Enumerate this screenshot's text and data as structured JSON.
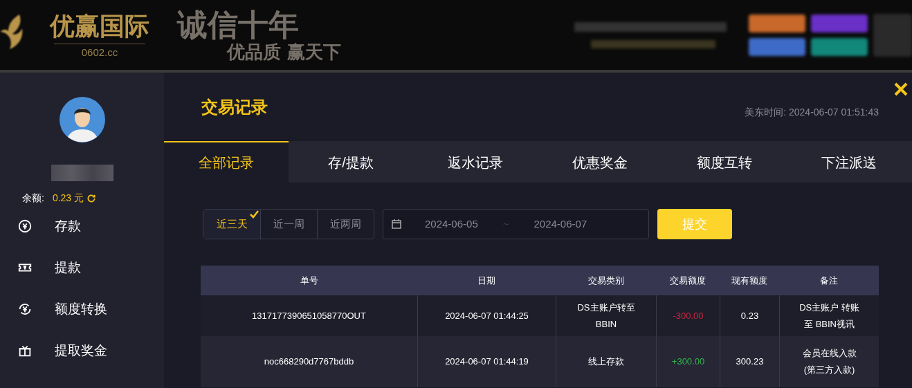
{
  "header": {
    "brand": "优赢国际",
    "domain": "0602.cc",
    "slogan": "诚信十年",
    "slogan_sub": "优品质 赢天下"
  },
  "sidebar": {
    "balance_label": "余额:",
    "balance": "0.23",
    "currency": "元",
    "items": [
      {
        "label": "存款",
        "kind": "deposit",
        "selected": false
      },
      {
        "label": "提款",
        "kind": "withdraw",
        "selected": false
      },
      {
        "label": "额度转换",
        "kind": "transfer",
        "selected": false
      },
      {
        "label": "提取奖金",
        "kind": "gift",
        "selected": false
      }
    ]
  },
  "panel": {
    "title": "交易记录",
    "time_label": "美东时间:",
    "time": "2024-06-07 01:51:43"
  },
  "tabs": [
    {
      "label": "全部记录",
      "selected": true
    },
    {
      "label": "存/提款",
      "selected": false
    },
    {
      "label": "返水记录",
      "selected": false
    },
    {
      "label": "优惠奖金",
      "selected": false
    },
    {
      "label": "额度互转",
      "selected": false
    },
    {
      "label": "下注派送",
      "selected": false
    }
  ],
  "ranges": [
    {
      "label": "近三天",
      "selected": true
    },
    {
      "label": "近一周",
      "selected": false
    },
    {
      "label": "近两周",
      "selected": false
    }
  ],
  "date_from": "2024-06-05",
  "date_sep": "~",
  "date_to": "2024-06-07",
  "submit": "提交",
  "table": {
    "columns": [
      "单号",
      "日期",
      "交易类别",
      "交易额度",
      "现有额度",
      "备注"
    ],
    "rows": [
      {
        "id": "1317177390651058770OUT",
        "date": "2024-06-07 01:44:25",
        "type": "DS主账户转至BBIN",
        "amount": "-300.00",
        "kind": "negative",
        "balance": "0.23",
        "note": "DS主账户 转账至 BBIN视讯"
      },
      {
        "id": "noc668290d7767bddb",
        "date": "2024-06-07 01:44:19",
        "type": "线上存款",
        "amount": "+300.00",
        "kind": "positive",
        "balance": "300.23",
        "note": "会员在线入款(第三方入款)"
      }
    ]
  }
}
